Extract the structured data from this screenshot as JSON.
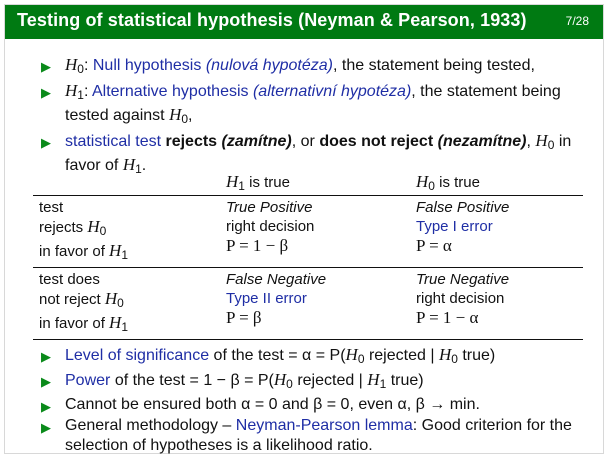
{
  "header": {
    "title": "Testing of statistical hypothesis (Neyman & Pearson, 1933)",
    "page": "7/28"
  },
  "b1": {
    "sym": "H",
    "sub": "0",
    "label": "Null hypothesis",
    "cz": "(nulová hypotéza)",
    "rest": ", the statement being tested,"
  },
  "b2": {
    "sym": "H",
    "sub": "1",
    "label": "Alternative hypothesis",
    "cz": "(alternativní hypotéza)",
    "rest": ", the statement being tested against",
    "h": "H",
    "hsub": "0",
    "end": ","
  },
  "b3": {
    "label": "statistical test",
    "rejects": "rejects",
    "cz1": "(zamítne)",
    "or": ", or",
    "notrej": "does not reject",
    "cz2": "(nezamítne)",
    "h0": "H",
    "h0sub": "0",
    "mid": "in favor of",
    "h1": "H",
    "h1sub": "1",
    "end": "."
  },
  "table": {
    "h_col1": {
      "sym": "H",
      "sub": "1",
      "text": "is true"
    },
    "h_col2": {
      "sym": "H",
      "sub": "0",
      "text": "is true"
    },
    "r1": {
      "c0": {
        "l1": "test",
        "l2": "rejects",
        "l2s": "H",
        "l2sub": "0",
        "l3": "in favor of",
        "l3s": "H",
        "l3sub": "1"
      },
      "c1": {
        "l1": "True Positive",
        "l2": "right decision",
        "l3": "P = 1 − β"
      },
      "c2": {
        "l1": "False Positive",
        "l2": "Type I error",
        "l3": "P = α"
      }
    },
    "r2": {
      "c0": {
        "l1": "test does",
        "l2": "not reject",
        "l2s": "H",
        "l2sub": "0",
        "l3": "in favor of",
        "l3s": "H",
        "l3sub": "1"
      },
      "c1": {
        "l1": "False Negative",
        "l2": "Type II error",
        "l3": "P = β"
      },
      "c2": {
        "l1": "True Negative",
        "l2": "right decision",
        "l3": "P = 1 − α"
      }
    }
  },
  "c1": {
    "label": "Level of significance",
    "rest": "of the test = α = P(",
    "h": "H",
    "hsub": "0",
    "mid": "rejected |",
    "h2": "H",
    "h2sub": "0",
    "end": "true)"
  },
  "c2": {
    "label": "Power",
    "rest": "of the test = 1 − β = P(",
    "h": "H",
    "hsub": "0",
    "mid": "rejected |",
    "h2": "H",
    "h2sub": "1",
    "end": "true)"
  },
  "c3": {
    "text": "Cannot be ensured both α = 0 and β = 0, even α, β → min."
  },
  "c4": {
    "pre": "General methodology –",
    "label": "Neyman-Pearson lemma",
    "rest": ": Good criterion for the selection of hypotheses is a likelihood ratio."
  },
  "colors": {
    "header_bg": "#007a12",
    "link_blue": "#1f2ea5",
    "bullet_green": "#0a8a1a"
  }
}
